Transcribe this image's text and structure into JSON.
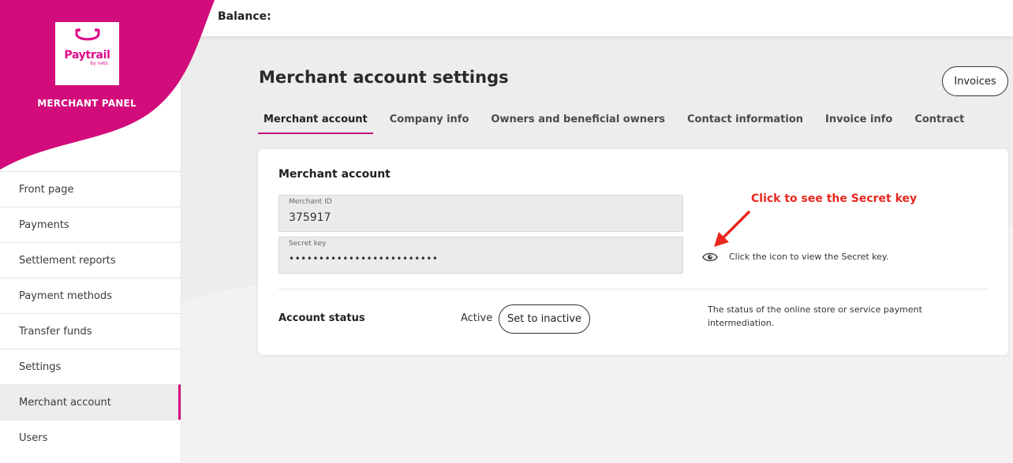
{
  "sidebar": {
    "logo_text": "Paytrail",
    "logo_sub": "by nets",
    "panel_label": "MERCHANT PANEL",
    "items": [
      {
        "label": "Front page"
      },
      {
        "label": "Payments"
      },
      {
        "label": "Settlement reports"
      },
      {
        "label": "Payment methods"
      },
      {
        "label": "Transfer funds"
      },
      {
        "label": "Settings"
      },
      {
        "label": "Merchant account",
        "active": true
      },
      {
        "label": "Users"
      }
    ]
  },
  "topbar": {
    "balance_label": "Balance:"
  },
  "main": {
    "title": "Merchant account settings",
    "invoices_button": "Invoices",
    "tabs": [
      {
        "label": "Merchant account",
        "active": true
      },
      {
        "label": "Company info"
      },
      {
        "label": "Owners and beneficial owners"
      },
      {
        "label": "Contact information"
      },
      {
        "label": "Invoice info"
      },
      {
        "label": "Contract"
      }
    ],
    "card": {
      "title": "Merchant account",
      "merchant_id_label": "Merchant ID",
      "merchant_id_value": "375917",
      "secret_key_label": "Secret key",
      "secret_key_value": "•••••••••••••••••••••••••",
      "annotation": "Click to see the Secret key",
      "eye_hint": "Click the icon to view the Secret key.",
      "status_label": "Account status",
      "status_value": "Active",
      "status_button": "Set to inactive",
      "status_description": "The status of the online store or service payment intermediation."
    }
  },
  "colors": {
    "brand": "#d30c7b",
    "annotation": "#e8281e"
  },
  "icons": [
    "shopping-bag-icon",
    "eye-icon",
    "red-arrow-icon"
  ]
}
